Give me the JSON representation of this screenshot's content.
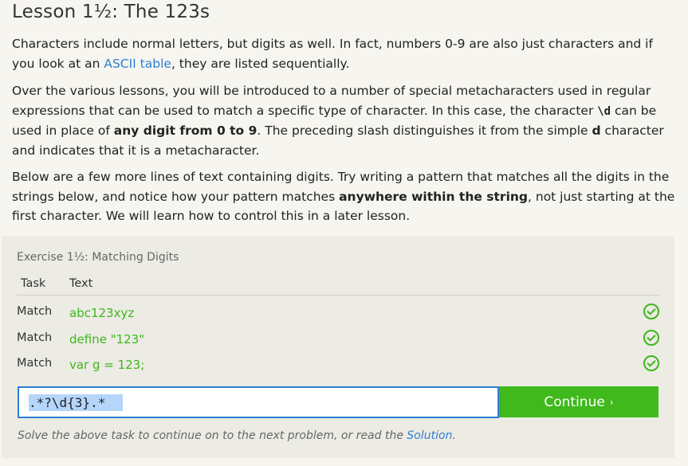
{
  "lesson": {
    "title": "Lesson 1½: The 123s",
    "p1_before": "Characters include normal letters, but digits as well. In fact, numbers 0-9 are also just characters and if you look at an ",
    "p1_link": "ASCII table",
    "p1_after": ", they are listed sequentially.",
    "p2_a": "Over the various lessons, you will be introduced to a number of special metacharacters used in regular expressions that can be used to match a specific type of character. In this case, the character ",
    "p2_code": "\\d",
    "p2_b": " can be used in place of ",
    "p2_bold": "any digit from 0 to 9",
    "p2_c": ". The preceding slash distinguishes it from the simple ",
    "p2_code2": "d",
    "p2_d": " character and indicates that it is a metacharacter.",
    "p3_a": "Below are a few more lines of text containing digits. Try writing a pattern that matches all the digits in the strings below, and notice how your pattern matches ",
    "p3_bold": "anywhere within the string",
    "p3_b": ", not just starting at the first character. We will learn how to control this in a later lesson."
  },
  "exercise": {
    "title": "Exercise 1½: Matching Digits",
    "col_task": "Task",
    "col_text": "Text",
    "rows": [
      {
        "task": "Match",
        "text": "abc123xyz",
        "status": "check-icon"
      },
      {
        "task": "Match",
        "text": "define \"123\"",
        "status": "check-icon"
      },
      {
        "task": "Match",
        "text": "var g = 123;",
        "status": "check-icon"
      }
    ],
    "input_value": ".*?\\d{3}.*",
    "continue_label": "Continue",
    "continue_chevron": "›",
    "hint_before": "Solve the above task to continue on to the next problem, or read the ",
    "hint_link": "Solution",
    "hint_after": ".",
    "accent_green": "#3fb91c",
    "accent_blue": "#2d7fd3"
  }
}
